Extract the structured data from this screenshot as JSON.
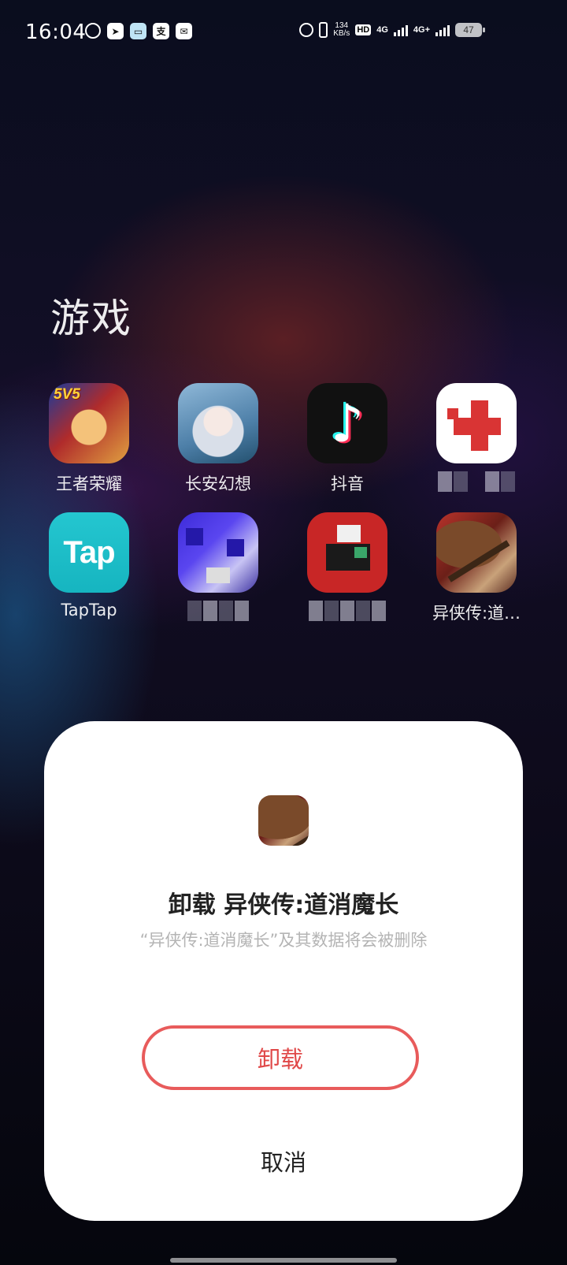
{
  "status_bar": {
    "time": "16:04",
    "network_speed_value": "134",
    "network_speed_unit": "KB/s",
    "hd_label": "HD",
    "net1": "4G",
    "net2": "4G+",
    "battery": "47",
    "notification_icons": [
      "weibo-icon",
      "send-icon",
      "keyboard-icon",
      "zhi-icon",
      "mail-icon"
    ]
  },
  "folder": {
    "title": "游戏",
    "apps": [
      {
        "label": "王者荣耀",
        "icon": "wangzherongyao-icon",
        "badge": "5V5"
      },
      {
        "label": "长安幻想",
        "icon": "changanhuanxiang-icon"
      },
      {
        "label": "抖音",
        "icon": "douyin-icon",
        "glyph": "♪"
      },
      {
        "label": "",
        "icon": "pixelated-app-icon-1"
      },
      {
        "label": "TapTap",
        "icon": "taptap-icon",
        "glyph": "Tap"
      },
      {
        "label": "",
        "icon": "pixelated-app-icon-2"
      },
      {
        "label": "",
        "icon": "pixelated-app-icon-3"
      },
      {
        "label": "异侠传:道…",
        "icon": "yixiazhuan-icon"
      }
    ]
  },
  "dialog": {
    "title": "卸载 异侠传:道消魔长",
    "description": "“异侠传:道消魔长”及其数据将会被删除",
    "uninstall_label": "卸载",
    "cancel_label": "取消",
    "accent_color": "#e85b5b"
  }
}
